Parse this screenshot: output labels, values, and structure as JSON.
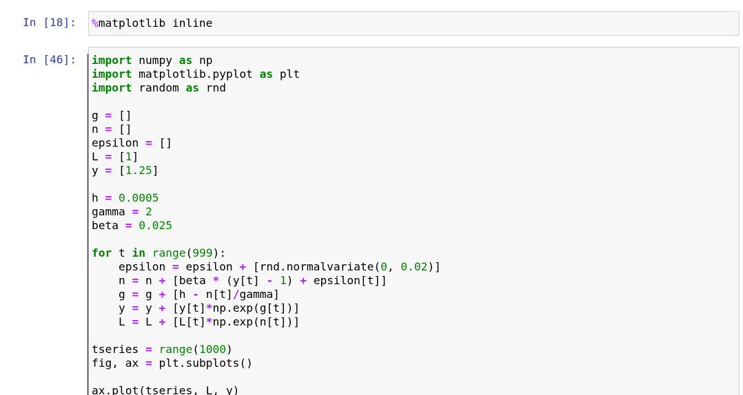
{
  "cells": [
    {
      "prompt": "In [18]:",
      "lines": [
        [
          [
            "magic",
            "%"
          ],
          [
            "nm",
            "matplotlib inline"
          ]
        ]
      ]
    },
    {
      "prompt": "In [46]:",
      "lines": [
        [
          [
            "kw",
            "import"
          ],
          [
            "nm",
            " numpy "
          ],
          [
            "kw",
            "as"
          ],
          [
            "nm",
            " np"
          ]
        ],
        [
          [
            "kw",
            "import"
          ],
          [
            "nm",
            " matplotlib.pyplot "
          ],
          [
            "kw",
            "as"
          ],
          [
            "nm",
            " plt"
          ]
        ],
        [
          [
            "kw",
            "import"
          ],
          [
            "nm",
            " random "
          ],
          [
            "kw",
            "as"
          ],
          [
            "nm",
            " rnd"
          ]
        ],
        [],
        [
          [
            "nm",
            "g "
          ],
          [
            "op",
            "="
          ],
          [
            "nm",
            " []"
          ]
        ],
        [
          [
            "nm",
            "n "
          ],
          [
            "op",
            "="
          ],
          [
            "nm",
            " []"
          ]
        ],
        [
          [
            "nm",
            "epsilon "
          ],
          [
            "op",
            "="
          ],
          [
            "nm",
            " []"
          ]
        ],
        [
          [
            "nm",
            "L "
          ],
          [
            "op",
            "="
          ],
          [
            "nm",
            " ["
          ],
          [
            "num",
            "1"
          ],
          [
            "nm",
            "]"
          ]
        ],
        [
          [
            "nm",
            "y "
          ],
          [
            "op",
            "="
          ],
          [
            "nm",
            " ["
          ],
          [
            "num",
            "1.25"
          ],
          [
            "nm",
            "]"
          ]
        ],
        [],
        [
          [
            "nm",
            "h "
          ],
          [
            "op",
            "="
          ],
          [
            "nm",
            " "
          ],
          [
            "num",
            "0.0005"
          ]
        ],
        [
          [
            "nm",
            "gamma "
          ],
          [
            "op",
            "="
          ],
          [
            "nm",
            " "
          ],
          [
            "num",
            "2"
          ]
        ],
        [
          [
            "nm",
            "beta "
          ],
          [
            "op",
            "="
          ],
          [
            "nm",
            " "
          ],
          [
            "num",
            "0.025"
          ]
        ],
        [],
        [
          [
            "kw",
            "for"
          ],
          [
            "nm",
            " t "
          ],
          [
            "kw",
            "in"
          ],
          [
            "nm",
            " "
          ],
          [
            "bi",
            "range"
          ],
          [
            "nm",
            "("
          ],
          [
            "num",
            "999"
          ],
          [
            "nm",
            "):"
          ]
        ],
        [
          [
            "nm",
            "    epsilon "
          ],
          [
            "op",
            "="
          ],
          [
            "nm",
            " epsilon "
          ],
          [
            "op",
            "+"
          ],
          [
            "nm",
            " [rnd.normalvariate("
          ],
          [
            "num",
            "0"
          ],
          [
            "nm",
            ", "
          ],
          [
            "num",
            "0.02"
          ],
          [
            "nm",
            ")]"
          ]
        ],
        [
          [
            "nm",
            "    n "
          ],
          [
            "op",
            "="
          ],
          [
            "nm",
            " n "
          ],
          [
            "op",
            "+"
          ],
          [
            "nm",
            " [beta "
          ],
          [
            "op",
            "*"
          ],
          [
            "nm",
            " (y[t] "
          ],
          [
            "op",
            "-"
          ],
          [
            "nm",
            " "
          ],
          [
            "num",
            "1"
          ],
          [
            "nm",
            ") "
          ],
          [
            "op",
            "+"
          ],
          [
            "nm",
            " epsilon[t]]"
          ]
        ],
        [
          [
            "nm",
            "    g "
          ],
          [
            "op",
            "="
          ],
          [
            "nm",
            " g "
          ],
          [
            "op",
            "+"
          ],
          [
            "nm",
            " [h "
          ],
          [
            "op",
            "-"
          ],
          [
            "nm",
            " n[t]"
          ],
          [
            "op",
            "/"
          ],
          [
            "nm",
            "gamma]"
          ]
        ],
        [
          [
            "nm",
            "    y "
          ],
          [
            "op",
            "="
          ],
          [
            "nm",
            " y "
          ],
          [
            "op",
            "+"
          ],
          [
            "nm",
            " [y[t]"
          ],
          [
            "op",
            "*"
          ],
          [
            "nm",
            "np.exp(g[t])]"
          ]
        ],
        [
          [
            "nm",
            "    L "
          ],
          [
            "op",
            "="
          ],
          [
            "nm",
            " L "
          ],
          [
            "op",
            "+"
          ],
          [
            "nm",
            " [L[t]"
          ],
          [
            "op",
            "*"
          ],
          [
            "nm",
            "np.exp(n[t])]"
          ]
        ],
        [],
        [
          [
            "nm",
            "tseries "
          ],
          [
            "op",
            "="
          ],
          [
            "nm",
            " "
          ],
          [
            "bi",
            "range"
          ],
          [
            "nm",
            "("
          ],
          [
            "num",
            "1000"
          ],
          [
            "nm",
            ")"
          ]
        ],
        [
          [
            "nm",
            "fig, ax "
          ],
          [
            "op",
            "="
          ],
          [
            "nm",
            " plt.subplots()"
          ]
        ],
        [],
        [
          [
            "nm",
            "ax.plot(tseries, L, y)"
          ]
        ]
      ]
    }
  ]
}
